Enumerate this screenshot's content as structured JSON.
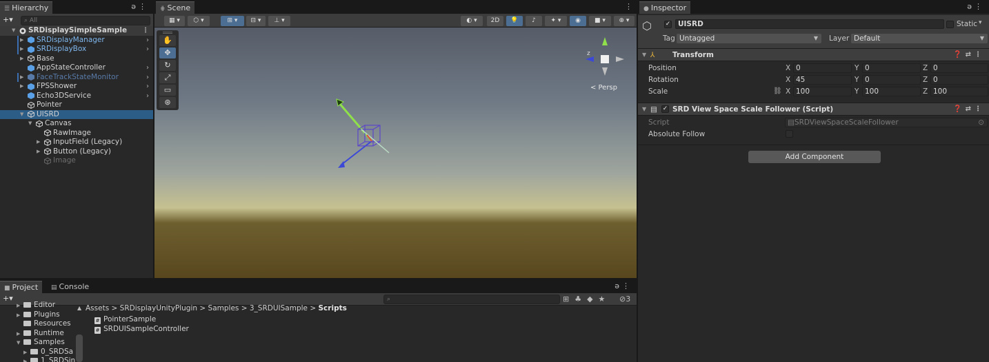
{
  "hierarchy": {
    "tab": "Hierarchy",
    "search_placeholder": "All",
    "add_label": "+▾",
    "items": [
      {
        "label": "SRDisplaySimpleSample",
        "style": "root",
        "indent": 0,
        "arrow": "▼"
      },
      {
        "label": "SRDisplayManager",
        "style": "prefab",
        "indent": 1,
        "arrow": "▶"
      },
      {
        "label": "SRDisplayBox",
        "style": "prefab",
        "indent": 1,
        "arrow": "▶"
      },
      {
        "label": "Base",
        "style": "normal",
        "indent": 1,
        "arrow": "▶"
      },
      {
        "label": "AppStateController",
        "style": "normal",
        "indent": 1,
        "arrow": ""
      },
      {
        "label": "FaceTrackStateMonitor",
        "style": "prefab-dim",
        "indent": 1,
        "arrow": "▶"
      },
      {
        "label": "FPSShower",
        "style": "normal",
        "indent": 1,
        "arrow": "▶"
      },
      {
        "label": "Echo3DService",
        "style": "normal",
        "indent": 1,
        "arrow": ""
      },
      {
        "label": "Pointer",
        "style": "normal",
        "indent": 1,
        "arrow": ""
      },
      {
        "label": "UISRD",
        "style": "sel",
        "indent": 1,
        "arrow": "▼"
      },
      {
        "label": "Canvas",
        "style": "normal",
        "indent": 2,
        "arrow": "▼"
      },
      {
        "label": "RawImage",
        "style": "normal",
        "indent": 3,
        "arrow": ""
      },
      {
        "label": "InputField (Legacy)",
        "style": "normal",
        "indent": 3,
        "arrow": "▶"
      },
      {
        "label": "Button (Legacy)",
        "style": "normal",
        "indent": 3,
        "arrow": "▶"
      },
      {
        "label": "Image",
        "style": "disabled",
        "indent": 3,
        "arrow": ""
      }
    ]
  },
  "scene": {
    "tab": "Scene",
    "twod_label": "2D",
    "persp_label": "< Persp",
    "axis_z_label": "z"
  },
  "inspector": {
    "tab": "Inspector",
    "object_name": "UISRD",
    "static_label": "Static",
    "tag_label": "Tag",
    "tag_value": "Untagged",
    "layer_label": "Layer",
    "layer_value": "Default",
    "transform": {
      "title": "Transform",
      "rows": [
        {
          "label": "Position",
          "x": "0",
          "y": "0",
          "z": "0"
        },
        {
          "label": "Rotation",
          "x": "45",
          "y": "0",
          "z": "0"
        },
        {
          "label": "Scale",
          "x": "100",
          "y": "100",
          "z": "100"
        }
      ]
    },
    "script_component": {
      "title": "SRD View Space Scale Follower (Script)",
      "script_label": "Script",
      "script_value": "SRDViewSpaceScaleFollower",
      "absolute_follow_label": "Absolute Follow"
    },
    "add_component_label": "Add Component"
  },
  "project": {
    "tab_project": "Project",
    "tab_console": "Console",
    "add_label": "+▾",
    "filter_count": "3",
    "folders": [
      {
        "label": "Editor",
        "indent": 1
      },
      {
        "label": "Plugins",
        "indent": 1
      },
      {
        "label": "Resources",
        "indent": 1
      },
      {
        "label": "Runtime",
        "indent": 1
      },
      {
        "label": "Samples",
        "indent": 1
      },
      {
        "label": "0_SRDSa",
        "indent": 2
      },
      {
        "label": "1_SRDSin",
        "indent": 2
      }
    ],
    "breadcrumb": [
      "Assets",
      "SRDisplayUnityPlugin",
      "Samples",
      "3_SRDUISample"
    ],
    "breadcrumb_current": "Scripts",
    "files": [
      "PointerSample",
      "SRDUISampleController"
    ]
  }
}
